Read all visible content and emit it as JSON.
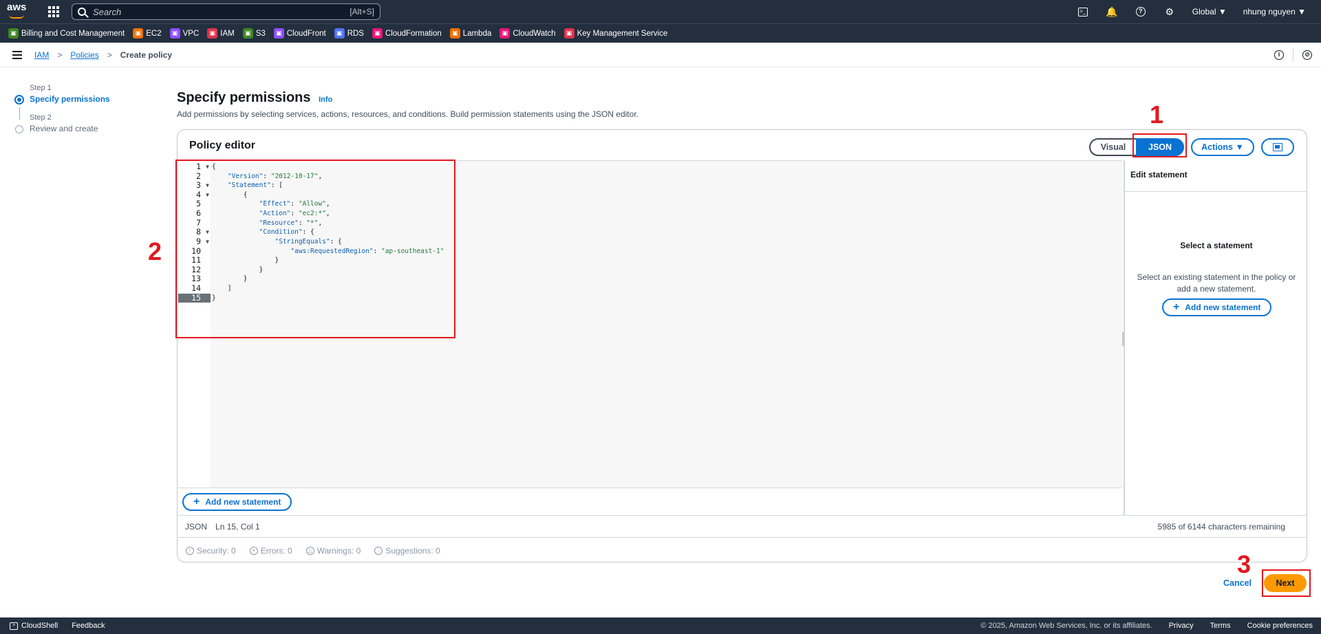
{
  "topbar": {
    "logo": "aws",
    "search_placeholder": "Search",
    "search_shortcut": "[Alt+S]",
    "icons": [
      "cloudshell-icon",
      "bell-icon",
      "help-icon",
      "gear-icon"
    ],
    "region": "Global ▼",
    "user": "nhung nguyen ▼"
  },
  "favorites": [
    {
      "label": "Billing and Cost Management",
      "color": "#3f8624"
    },
    {
      "label": "EC2",
      "color": "#ed7100"
    },
    {
      "label": "VPC",
      "color": "#8c4fff"
    },
    {
      "label": "IAM",
      "color": "#dd344c"
    },
    {
      "label": "S3",
      "color": "#3f8624"
    },
    {
      "label": "CloudFront",
      "color": "#8c4fff"
    },
    {
      "label": "RDS",
      "color": "#4d72f3"
    },
    {
      "label": "CloudFormation",
      "color": "#e7157b"
    },
    {
      "label": "Lambda",
      "color": "#ed7100"
    },
    {
      "label": "CloudWatch",
      "color": "#e7157b"
    },
    {
      "label": "Key Management Service",
      "color": "#dd344c"
    }
  ],
  "breadcrumb": {
    "items": [
      "IAM",
      "Policies"
    ],
    "current": "Create policy"
  },
  "steps": [
    {
      "small": "Step 1",
      "title": "Specify permissions"
    },
    {
      "small": "Step 2",
      "title": "Review and create"
    }
  ],
  "header": {
    "title": "Specify permissions",
    "info": "Info",
    "description": "Add permissions by selecting services, actions, resources, and conditions. Build permission statements using the JSON editor."
  },
  "editor": {
    "title": "Policy editor",
    "mode_visual": "Visual",
    "mode_json": "JSON",
    "actions": "Actions ▼",
    "lines": [
      "{",
      "    \"Version\": \"2012-10-17\",",
      "    \"Statement\": [",
      "        {",
      "            \"Effect\": \"Allow\",",
      "            \"Action\": \"ec2:*\",",
      "            \"Resource\": \"*\",",
      "            \"Condition\": {",
      "                \"StringEquals\": {",
      "                    \"aws:RequestedRegion\": \"ap-southeast-1\"",
      "                }",
      "            }",
      "        }",
      "    ]",
      "}"
    ],
    "add_statement": "Add new statement",
    "status_mode": "JSON",
    "status_position": "Ln 15, Col 1",
    "chars_remaining": "5985 of 6144 characters remaining",
    "security": "Security: 0",
    "errors": "Errors: 0",
    "warnings": "Warnings: 0",
    "suggestions": "Suggestions: 0"
  },
  "side_panel": {
    "header": "Edit statement",
    "title": "Select a statement",
    "description_1": "Select an existing statement in the policy or",
    "description_2": "add a new statement.",
    "add_button": "Add new statement"
  },
  "footer_actions": {
    "cancel": "Cancel",
    "next": "Next"
  },
  "annotations": [
    "1",
    "2",
    "3"
  ],
  "footer": {
    "cloudshell": "CloudShell",
    "feedback": "Feedback",
    "copyright": "© 2025, Amazon Web Services, Inc. or its affiliates.",
    "privacy": "Privacy",
    "terms": "Terms",
    "cookies": "Cookie preferences"
  }
}
